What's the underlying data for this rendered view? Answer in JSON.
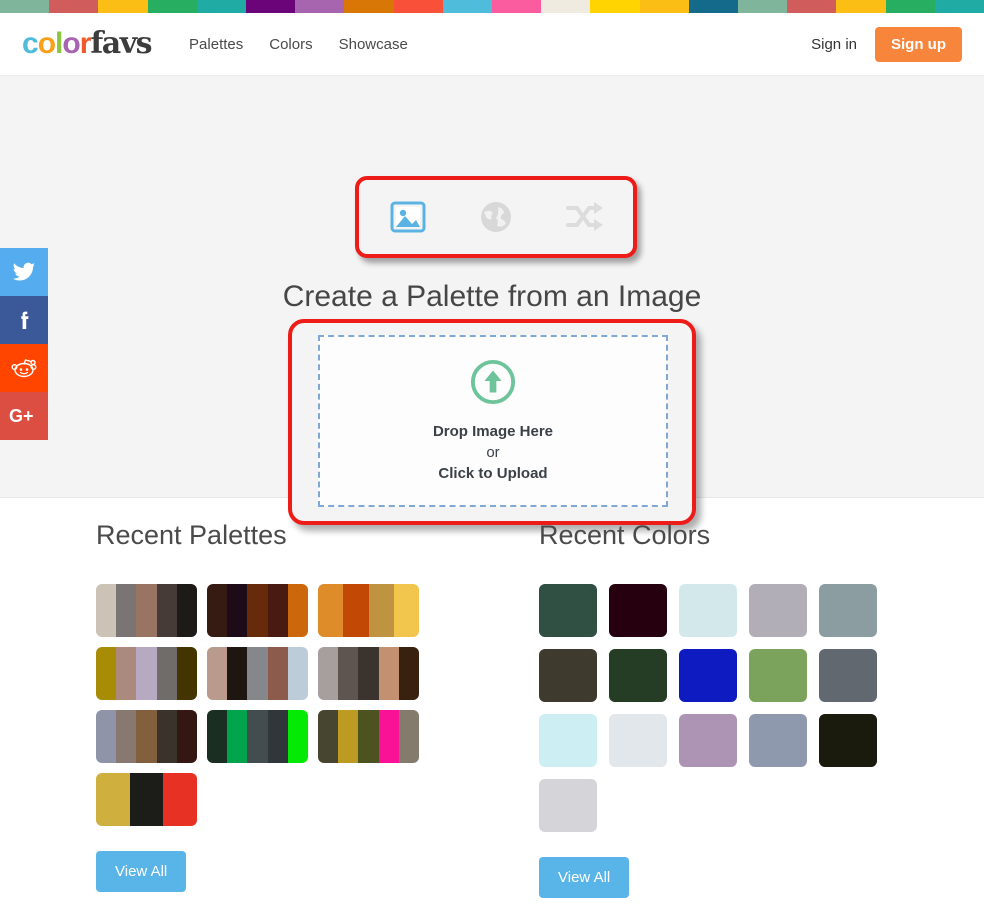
{
  "stripe_colors": [
    "#7fb59b",
    "#d15c5c",
    "#fbbe15",
    "#27ae60",
    "#21aba5",
    "#6b0478",
    "#a765b0",
    "#d97706",
    "#f9503a",
    "#4fbcdc",
    "#fb5ca0",
    "#f0ebe0",
    "#ffd400",
    "#fbbe15",
    "#136a8a",
    "#7fb59b",
    "#d15c5c",
    "#fbbe15",
    "#27ae60",
    "#21aba5"
  ],
  "header": {
    "logo": {
      "part1": "color",
      "part2": "favs",
      "letters": [
        {
          "ch": "c",
          "color": "#4fbcdc"
        },
        {
          "ch": "o",
          "color": "#f9a11b"
        },
        {
          "ch": "l",
          "color": "#8bc63f"
        },
        {
          "ch": "o",
          "color": "#a765b0"
        },
        {
          "ch": "r",
          "color": "#f15a29"
        }
      ]
    },
    "nav": [
      {
        "label": "Palettes",
        "name": "nav-palettes"
      },
      {
        "label": "Colors",
        "name": "nav-colors"
      },
      {
        "label": "Showcase",
        "name": "nav-showcase"
      }
    ],
    "sign_in": "Sign in",
    "sign_up": "Sign up",
    "signup_color": "#f7863c"
  },
  "hero": {
    "modes": [
      {
        "name": "image-mode",
        "icon": "image-icon",
        "active": true,
        "color": "#5bb3e4"
      },
      {
        "name": "globe-mode",
        "icon": "globe-icon",
        "active": false,
        "color": "#d8d8d8"
      },
      {
        "name": "shuffle-mode",
        "icon": "shuffle-icon",
        "active": false,
        "color": "#dcdcdc"
      }
    ],
    "title": "Create a Palette from an Image",
    "drop": {
      "line1": "Drop Image Here",
      "line2": "or",
      "line3": "Click to Upload",
      "icon_color": "#6ec49a",
      "border_color": "#7fa8d4"
    },
    "highlight_color": "#ee1c18"
  },
  "social": [
    {
      "name": "twitter-share",
      "glyph": "t",
      "bg": "#55acee",
      "label": "Twitter"
    },
    {
      "name": "facebook-share",
      "glyph": "f",
      "bg": "#3b5998",
      "label": "Facebook"
    },
    {
      "name": "reddit-share",
      "glyph": "r",
      "bg": "#ff4500",
      "label": "Reddit"
    },
    {
      "name": "googleplus-share",
      "glyph": "G+",
      "bg": "#dc4e41",
      "label": "Google Plus"
    }
  ],
  "recent_palettes": {
    "title": "Recent Palettes",
    "view_all": "View All",
    "items": [
      [
        "#cdc2b6",
        "#7a7474",
        "#9a7463",
        "#473b37",
        "#1d1a18"
      ],
      [
        "#361b13",
        "#1d0c17",
        "#672b0c",
        "#481a11",
        "#cc680b"
      ],
      [
        "#de8b29",
        "#c24806",
        "#bf9340",
        "#f2c64c"
      ],
      [
        "#a88c05",
        "#ab8a7d",
        "#b7a9c2",
        "#706c69",
        "#443500"
      ],
      [
        "#b99a8d",
        "#1e1610",
        "#85878b",
        "#8d5b4b",
        "#bcccd9"
      ],
      [
        "#a79e9e",
        "#5e5550",
        "#3b332e",
        "#c39172",
        "#38210f"
      ],
      [
        "#9094a9",
        "#87796f",
        "#82603e",
        "#3a332c",
        "#341712"
      ],
      [
        "#1a2e22",
        "#00a44d",
        "#434d4f",
        "#31363a",
        "#04ea04"
      ],
      [
        "#474530",
        "#bd9b22",
        "#4c5320",
        "#f91196",
        "#847b6c"
      ],
      [
        "#cfb03f",
        "#1c1c18",
        "#e63124"
      ]
    ]
  },
  "recent_colors": {
    "title": "Recent Colors",
    "view_all": "View All",
    "items": [
      "#2f5042",
      "#26000f",
      "#d3e8ea",
      "#b1aeb8",
      "#8c9da2",
      "#3e3a2d",
      "#253c25",
      "#0d1bc1",
      "#7ba35b",
      "#626870",
      "#cdeff4",
      "#e2e7eb",
      "#ad94b4",
      "#8f99ae",
      "#1a1b0d",
      "#d4d4d9"
    ]
  },
  "buttons": {
    "view_all_color": "#59b4e8"
  }
}
